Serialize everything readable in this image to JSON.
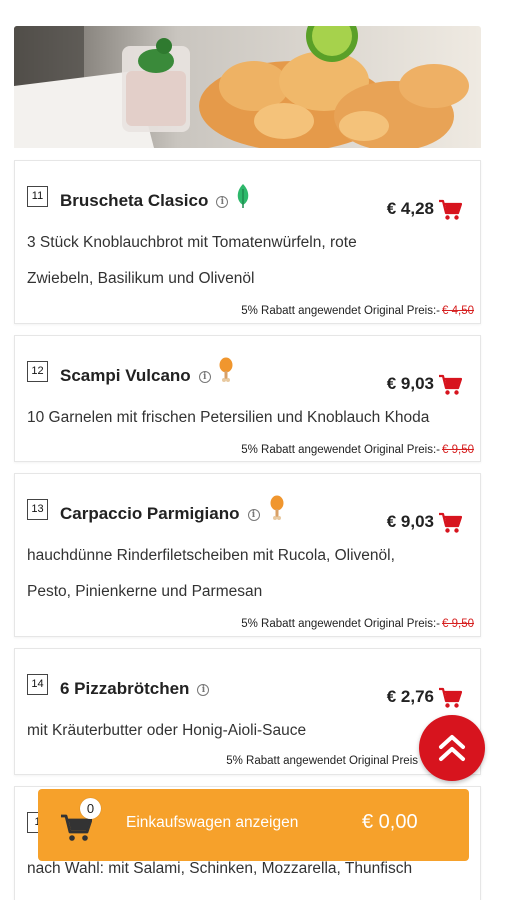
{
  "menu": {
    "items": [
      {
        "number": "11",
        "title": "Bruscheta Clasico",
        "badge": "vegan-leaf-icon",
        "price": "€ 4,28",
        "desc_lines": [
          "3 Stück Knoblauchbrot mit Tomatenwürfeln, rote",
          "Zwiebeln, Basilikum und Olivenöl"
        ],
        "discount_text": "5% Rabatt angewendet Original Preis:-",
        "original_price": "€ 4,50"
      },
      {
        "number": "12",
        "title": "Scampi Vulcano",
        "badge": "chicken-leg-icon",
        "price": "€ 9,03",
        "desc_lines": [
          "10 Garnelen mit frischen Petersilien und Knoblauch Khoda"
        ],
        "discount_text": "5% Rabatt angewendet Original Preis:-",
        "original_price": "€ 9,50"
      },
      {
        "number": "13",
        "title": "Carpaccio Parmigiano",
        "badge": "chicken-leg-icon",
        "price": "€ 9,03",
        "desc_lines": [
          "hauchdünne Rinderfiletscheiben mit Rucola, Olivenöl,",
          "Pesto, Pinienkerne und Parmesan"
        ],
        "discount_text": "5% Rabatt angewendet Original Preis:-",
        "original_price": "€ 9,50"
      },
      {
        "number": "14",
        "title": "6 Pizzabrötchen",
        "badge": "",
        "price": "€ 2,76",
        "desc_lines": [
          "mit Kräuterbutter oder Honig-Aioli-Sauce"
        ],
        "discount_text": "5% Rabatt angewendet Original Preis",
        "original_price": ""
      },
      {
        "number": "1",
        "title": "",
        "badge": "",
        "price": "",
        "desc_lines": [
          "nach Wahl: mit Salami, Schinken, Mozzarella, Thunfisch"
        ],
        "discount_text": "",
        "original_price": ""
      }
    ]
  },
  "cart": {
    "count": "0",
    "label": "Einkaufswagen anzeigen",
    "total": "€ 0,00"
  },
  "colors": {
    "accent_red": "#d7141e",
    "cart_orange": "#f6a12b",
    "leaf_green": "#2eb86b",
    "drumstick_orange": "#f0962e"
  },
  "icons": {
    "info": "info-icon",
    "add_to_cart": "shopping-cart-icon",
    "scroll_top": "double-chevron-up-icon"
  }
}
